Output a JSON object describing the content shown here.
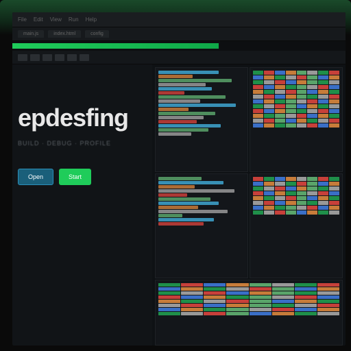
{
  "titlebar": {
    "menu": [
      "File",
      "Edit",
      "View",
      "Run",
      "Help"
    ]
  },
  "tabs": [
    "main.js",
    "index.html",
    "config"
  ],
  "progress": {
    "percent": 62
  },
  "hero": {
    "logo": "epdesfing",
    "subtitle": "BUILD · DEBUG · PROFILE",
    "primary_label": "Start",
    "secondary_label": "Open"
  },
  "colors": {
    "accent": "#1fcc5a",
    "bg": "#111417",
    "panel": "#13161a"
  },
  "code_panel_1": [
    {
      "w": 70,
      "c": "#3fa6d1"
    },
    {
      "w": 40,
      "c": "#c77c3a"
    },
    {
      "w": 85,
      "c": "#5aa46a"
    },
    {
      "w": 55,
      "c": "#999"
    },
    {
      "w": 62,
      "c": "#3fa6d1"
    },
    {
      "w": 30,
      "c": "#c7403a"
    },
    {
      "w": 78,
      "c": "#5aa46a"
    },
    {
      "w": 48,
      "c": "#999"
    },
    {
      "w": 90,
      "c": "#3fa6d1"
    },
    {
      "w": 35,
      "c": "#c77c3a"
    },
    {
      "w": 66,
      "c": "#5aa46a"
    },
    {
      "w": 52,
      "c": "#999"
    },
    {
      "w": 44,
      "c": "#c7403a"
    },
    {
      "w": 72,
      "c": "#3fa6d1"
    },
    {
      "w": 58,
      "c": "#5aa46a"
    },
    {
      "w": 38,
      "c": "#999"
    }
  ],
  "code_panel_2": [
    {
      "w": 50,
      "c": "#5aa46a"
    },
    {
      "w": 75,
      "c": "#3fa6d1"
    },
    {
      "w": 42,
      "c": "#c77c3a"
    },
    {
      "w": 88,
      "c": "#999"
    },
    {
      "w": 33,
      "c": "#c7403a"
    },
    {
      "w": 60,
      "c": "#5aa46a"
    },
    {
      "w": 70,
      "c": "#3fa6d1"
    },
    {
      "w": 46,
      "c": "#c77c3a"
    },
    {
      "w": 80,
      "c": "#999"
    },
    {
      "w": 28,
      "c": "#5aa46a"
    },
    {
      "w": 64,
      "c": "#3fa6d1"
    },
    {
      "w": 52,
      "c": "#c7403a"
    }
  ],
  "thumbs_1": [
    "#1f8f4a",
    "#c7403a",
    "#3a6fc7",
    "#c77c3a",
    "#5aa46a",
    "#999",
    "#1f8f4a",
    "#c7403a",
    "#3a6fc7",
    "#c77c3a",
    "#1f8f4a",
    "#999",
    "#c7403a",
    "#5aa46a",
    "#3a6fc7",
    "#c77c3a",
    "#1f8f4a",
    "#999",
    "#c7403a",
    "#3a6fc7",
    "#c77c3a",
    "#5aa46a",
    "#1f8f4a",
    "#999",
    "#c7403a",
    "#3a6fc7",
    "#c77c3a",
    "#1f8f4a",
    "#5aa46a",
    "#999",
    "#c7403a",
    "#3a6fc7",
    "#c77c3a",
    "#1f8f4a",
    "#999",
    "#c7403a",
    "#5aa46a",
    "#3a6fc7",
    "#c77c3a",
    "#1f8f4a",
    "#999",
    "#c7403a",
    "#3a6fc7",
    "#c77c3a",
    "#5aa46a",
    "#1f8f4a",
    "#999",
    "#c7403a",
    "#3a6fc7",
    "#c77c3a",
    "#1f8f4a",
    "#5aa46a",
    "#999",
    "#c7403a",
    "#3a6fc7",
    "#c77c3a",
    "#1f8f4a",
    "#999",
    "#c7403a",
    "#5aa46a",
    "#3a6fc7",
    "#c77c3a",
    "#1f8f4a",
    "#999",
    "#c7403a",
    "#3a6fc7",
    "#c77c3a",
    "#5aa46a",
    "#1f8f4a",
    "#999",
    "#c7403a",
    "#3a6fc7",
    "#c77c3a",
    "#1f8f4a",
    "#5aa46a",
    "#999",
    "#c7403a",
    "#3a6fc7",
    "#c77c3a",
    "#1f8f4a",
    "#999",
    "#c7403a",
    "#5aa46a",
    "#3a6fc7",
    "#c77c3a",
    "#1f8f4a",
    "#999",
    "#c7403a",
    "#3a6fc7",
    "#c77c3a",
    "#1f8f4a",
    "#5aa46a",
    "#999",
    "#c7403a",
    "#3a6fc7",
    "#c77c3a"
  ],
  "thumbs_2": [
    "#c7403a",
    "#1f8f4a",
    "#3a6fc7",
    "#c77c3a",
    "#999",
    "#5aa46a",
    "#c7403a",
    "#1f8f4a",
    "#3a6fc7",
    "#c77c3a",
    "#999",
    "#1f8f4a",
    "#c7403a",
    "#5aa46a",
    "#3a6fc7",
    "#c77c3a",
    "#1f8f4a",
    "#999",
    "#c7403a",
    "#3a6fc7",
    "#c77c3a",
    "#5aa46a",
    "#1f8f4a",
    "#999",
    "#c7403a",
    "#3a6fc7",
    "#c77c3a",
    "#1f8f4a",
    "#5aa46a",
    "#999",
    "#c7403a",
    "#3a6fc7",
    "#c77c3a",
    "#1f8f4a",
    "#999",
    "#c7403a",
    "#5aa46a",
    "#3a6fc7",
    "#c77c3a",
    "#1f8f4a",
    "#999",
    "#c7403a",
    "#3a6fc7",
    "#c77c3a",
    "#5aa46a",
    "#1f8f4a",
    "#999",
    "#c7403a",
    "#3a6fc7",
    "#c77c3a",
    "#1f8f4a",
    "#5aa46a",
    "#999",
    "#c7403a",
    "#3a6fc7",
    "#c77c3a",
    "#1f8f4a",
    "#999",
    "#c7403a",
    "#5aa46a",
    "#3a6fc7",
    "#c77c3a",
    "#1f8f4a",
    "#999"
  ]
}
